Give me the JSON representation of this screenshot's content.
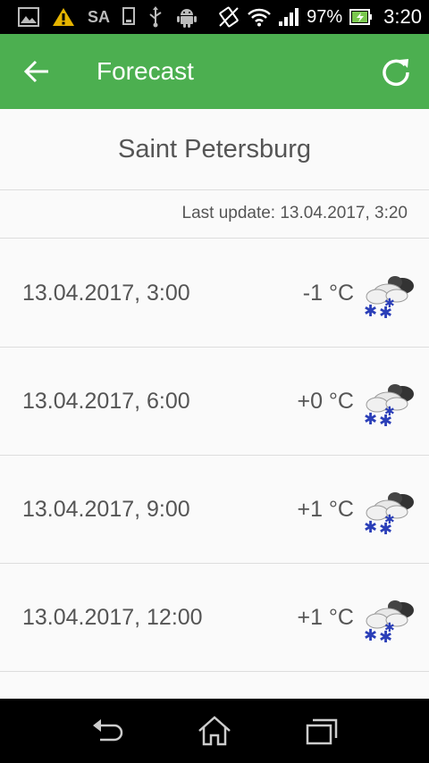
{
  "status_bar": {
    "carrier": "SA",
    "battery_percent": "97%",
    "time": "3:20",
    "icons": [
      "image-notification-icon",
      "warning-icon",
      "sim-icon",
      "usb-icon",
      "android-debug-icon",
      "vibrate-icon",
      "wifi-icon",
      "signal-icon",
      "battery-charging-icon"
    ]
  },
  "app_bar": {
    "title": "Forecast",
    "back_icon": "arrow-left-icon",
    "refresh_icon": "refresh-icon",
    "color": "#4caf50"
  },
  "city": "Saint Petersburg",
  "last_update": "Last update: 13.04.2017, 3:20",
  "forecast": [
    {
      "datetime": "13.04.2017, 3:00",
      "temp": "-1 °C",
      "icon": "snow-cloud-icon"
    },
    {
      "datetime": "13.04.2017, 6:00",
      "temp": "+0 °C",
      "icon": "snow-cloud-icon"
    },
    {
      "datetime": "13.04.2017, 9:00",
      "temp": "+1 °C",
      "icon": "snow-cloud-icon"
    },
    {
      "datetime": "13.04.2017, 12:00",
      "temp": "+1 °C",
      "icon": "snow-cloud-icon"
    }
  ],
  "nav_bar": {
    "icons": [
      "back-nav-icon",
      "home-nav-icon",
      "recents-nav-icon"
    ]
  }
}
